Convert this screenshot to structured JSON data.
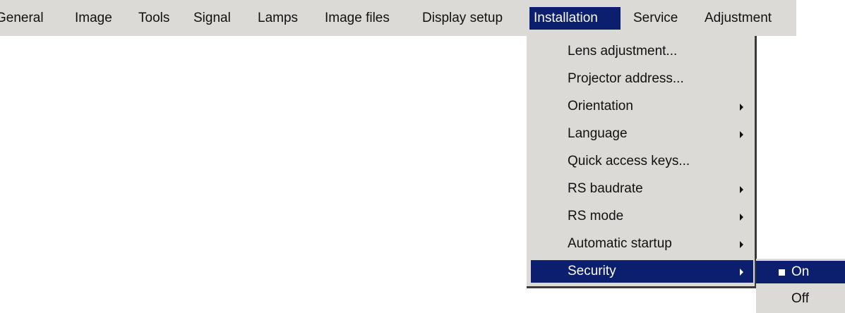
{
  "menubar": {
    "items": [
      {
        "label": "General"
      },
      {
        "label": "Image"
      },
      {
        "label": "Tools"
      },
      {
        "label": "Signal"
      },
      {
        "label": "Lamps"
      },
      {
        "label": "Image files"
      },
      {
        "label": "Display setup"
      },
      {
        "label": "Installation",
        "active": true
      },
      {
        "label": "Service"
      },
      {
        "label": "Adjustment"
      }
    ]
  },
  "installation_menu": {
    "items": [
      {
        "label": "Lens adjustment...",
        "submenu": false
      },
      {
        "label": "Projector address...",
        "submenu": false
      },
      {
        "label": "Orientation",
        "submenu": true
      },
      {
        "label": "Language",
        "submenu": true
      },
      {
        "label": "Quick access keys...",
        "submenu": false
      },
      {
        "label": "RS baudrate",
        "submenu": true
      },
      {
        "label": "RS mode",
        "submenu": true
      },
      {
        "label": "Automatic startup",
        "submenu": true
      },
      {
        "label": "Security",
        "submenu": true,
        "selected": true
      }
    ]
  },
  "security_submenu": {
    "items": [
      {
        "label": "On",
        "checked": true,
        "selected": true
      },
      {
        "label": "Off",
        "checked": false
      }
    ]
  },
  "colors": {
    "menu_background": "#dcdad6",
    "selection": "#0c1f6e",
    "text": "#111111"
  }
}
